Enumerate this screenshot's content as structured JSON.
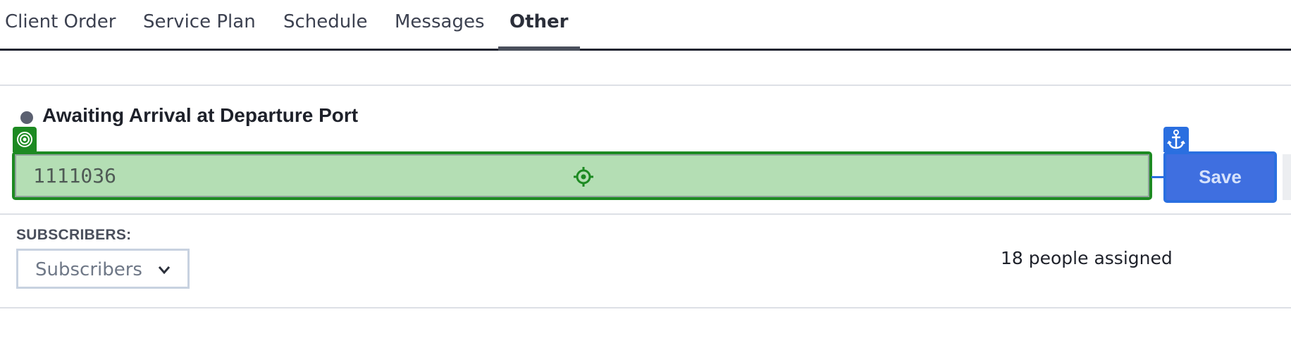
{
  "tabs": [
    {
      "label": "Client Order",
      "active": false
    },
    {
      "label": "Service Plan",
      "active": false
    },
    {
      "label": "Schedule",
      "active": false
    },
    {
      "label": "Messages",
      "active": false
    },
    {
      "label": "Other",
      "active": true
    }
  ],
  "status": {
    "text": "Awaiting Arrival at Departure Port"
  },
  "tracking_input": {
    "value": "1111036"
  },
  "save_button": {
    "label": "Save"
  },
  "subscribers": {
    "label": "SUBSCRIBERS:",
    "selected": "Subscribers",
    "assigned_text": "18 people assigned"
  },
  "icons": {
    "green_marker": "target-icon",
    "crosshair": "crosshair-icon",
    "blue_marker": "anchor-icon",
    "dropdown": "chevron-down-icon"
  },
  "colors": {
    "focus_green": "#1d8a22",
    "input_fill": "#b4deb4",
    "accent_blue": "#2a6fe0",
    "save_fill": "#3f6fe0",
    "text_dark": "#1e212a"
  }
}
